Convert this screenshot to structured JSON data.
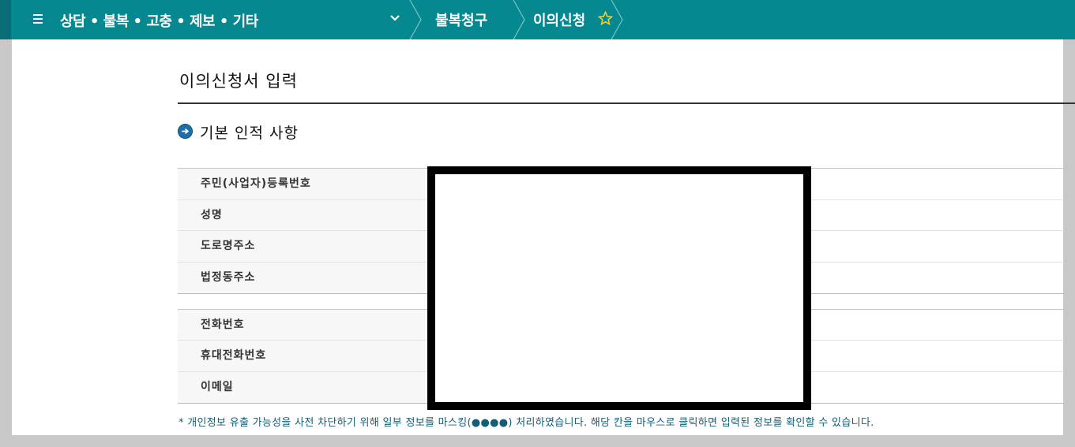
{
  "header": {
    "main_crumb": "상담 • 불복 • 고충 • 제보 • 기타",
    "crumb2": "불복청구",
    "crumb3": "이의신청"
  },
  "page": {
    "title": "이의신청서 입력",
    "section_title": "기본 인적 사항"
  },
  "form": {
    "rows": [
      {
        "label": "주민(사업자)등록번호"
      },
      {
        "label": "성명"
      },
      {
        "label": "도로명주소"
      },
      {
        "label": "법정동주소"
      },
      {
        "label": "전화번호"
      },
      {
        "label": "휴대전화번호"
      },
      {
        "label": "이메일"
      }
    ]
  },
  "notice": "* 개인정보 유출 가능성을 사전 차단하기 위해 일부 정보를 마스킹(●●●●) 처리하였습니다. 해당 칸을 마우스로 클릭하면 입력된 정보를 확인할 수 있습니다.",
  "colors": {
    "header_bg": "#05888f",
    "star": "#e8d63a",
    "notice_text": "#135d75",
    "section_icon": "#1d6fa8"
  }
}
